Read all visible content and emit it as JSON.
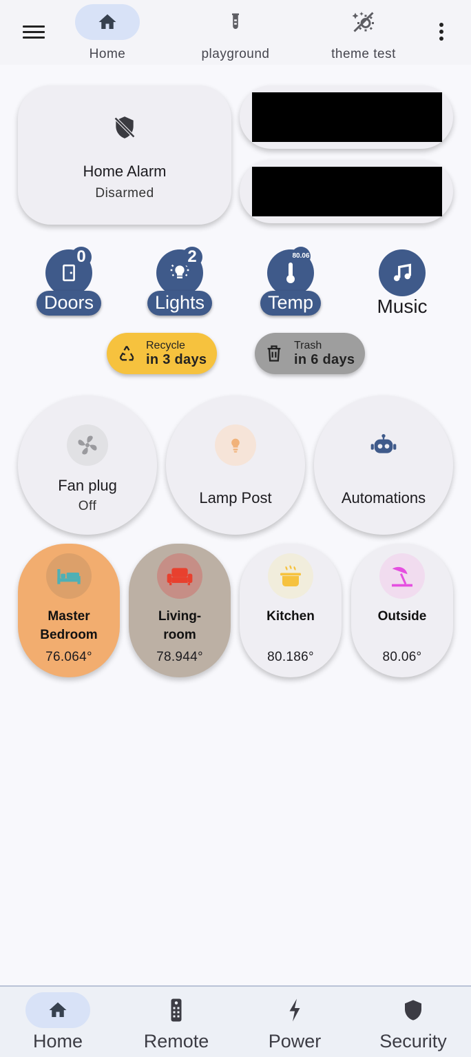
{
  "top_tabs": [
    {
      "label": "Home",
      "icon": "home-icon",
      "active": true
    },
    {
      "label": "playground",
      "icon": "test-tube-icon",
      "active": false
    },
    {
      "label": "theme test",
      "icon": "theme-weather-icon",
      "active": false
    }
  ],
  "alarm": {
    "title": "Home Alarm",
    "state": "Disarmed",
    "icon": "shield-off-icon"
  },
  "shortcuts": [
    {
      "label": "Doors",
      "badge": "0",
      "icon": "door-icon"
    },
    {
      "label": "Lights",
      "badge": "2",
      "icon": "light-icon"
    },
    {
      "label": "Temp",
      "badge": "80.06",
      "icon": "thermometer-icon"
    },
    {
      "label": "Music",
      "icon": "music-note-icon"
    }
  ],
  "bins": [
    {
      "line1": "Recycle",
      "line2": "in 3 days",
      "color": "#f6c23e",
      "icon": "recycle-icon"
    },
    {
      "line1": "Trash",
      "line2": "in 6 days",
      "color": "#9e9e9e",
      "icon": "trash-icon"
    }
  ],
  "cards": [
    {
      "title": "Fan plug",
      "state": "Off",
      "icon": "fan-icon"
    },
    {
      "title": "Lamp Post",
      "icon": "lightbulb-icon"
    },
    {
      "title": "Automations",
      "icon": "robot-icon"
    }
  ],
  "rooms": [
    {
      "name_line1": "Master",
      "name_line2": "Bedroom",
      "temp": "76.064°",
      "bg": "#f2ad6f",
      "icon": "bed-icon"
    },
    {
      "name_line1": "Living-",
      "name_line2": "room",
      "temp": "78.944°",
      "bg": "#bcb0a4",
      "icon": "sofa-icon"
    },
    {
      "name_line1": "Kitchen",
      "name_line2": "",
      "temp": "80.186°",
      "bg": "#efeef3",
      "icon": "pot-steam-icon"
    },
    {
      "name_line1": "Outside",
      "name_line2": "",
      "temp": "80.06°",
      "bg": "#efeef3",
      "icon": "beach-umbrella-icon"
    }
  ],
  "bottom_nav": [
    {
      "label": "Home",
      "icon": "home-icon",
      "active": true
    },
    {
      "label": "Remote",
      "icon": "remote-icon",
      "active": false
    },
    {
      "label": "Power",
      "icon": "flash-icon",
      "active": false
    },
    {
      "label": "Security",
      "icon": "shield-icon",
      "active": false
    }
  ]
}
